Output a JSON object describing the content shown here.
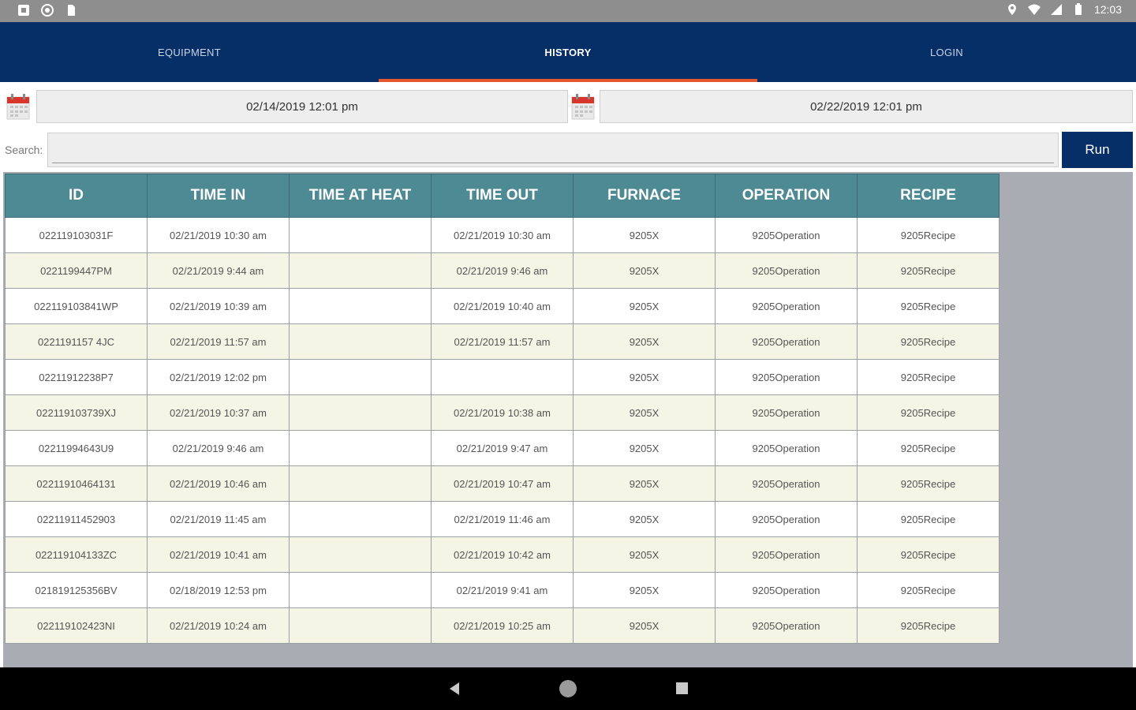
{
  "status_bar": {
    "time": "12:03"
  },
  "nav": {
    "tabs": [
      {
        "label": "EQUIPMENT",
        "active": false
      },
      {
        "label": "HISTORY",
        "active": true
      },
      {
        "label": "LOGIN",
        "active": false
      }
    ]
  },
  "dates": {
    "start": "02/14/2019 12:01 pm",
    "end": "02/22/2019 12:01 pm"
  },
  "search": {
    "label": "Search:",
    "value": "",
    "run_label": "Run"
  },
  "table": {
    "columns": [
      "ID",
      "TIME IN",
      "TIME AT HEAT",
      "TIME OUT",
      "FURNACE",
      "OPERATION",
      "RECIPE"
    ],
    "rows": [
      [
        "022119103031F",
        "02/21/2019 10:30 am",
        "",
        "02/21/2019 10:30 am",
        "9205X",
        "9205Operation",
        "9205Recipe"
      ],
      [
        "0221199447PM",
        "02/21/2019 9:44 am",
        "",
        "02/21/2019 9:46 am",
        "9205X",
        "9205Operation",
        "9205Recipe"
      ],
      [
        "022119103841WP",
        "02/21/2019 10:39 am",
        "",
        "02/21/2019 10:40 am",
        "9205X",
        "9205Operation",
        "9205Recipe"
      ],
      [
        "0221191157 4JC",
        "02/21/2019 11:57 am",
        "",
        "02/21/2019 11:57 am",
        "9205X",
        "9205Operation",
        "9205Recipe"
      ],
      [
        "02211912238P7",
        "02/21/2019 12:02 pm",
        "",
        "",
        "9205X",
        "9205Operation",
        "9205Recipe"
      ],
      [
        "022119103739XJ",
        "02/21/2019 10:37 am",
        "",
        "02/21/2019 10:38 am",
        "9205X",
        "9205Operation",
        "9205Recipe"
      ],
      [
        "02211994643U9",
        "02/21/2019 9:46 am",
        "",
        "02/21/2019 9:47 am",
        "9205X",
        "9205Operation",
        "9205Recipe"
      ],
      [
        "02211910464131",
        "02/21/2019 10:46 am",
        "",
        "02/21/2019 10:47 am",
        "9205X",
        "9205Operation",
        "9205Recipe"
      ],
      [
        "02211911452903",
        "02/21/2019 11:45 am",
        "",
        "02/21/2019 11:46 am",
        "9205X",
        "9205Operation",
        "9205Recipe"
      ],
      [
        "022119104133ZC",
        "02/21/2019 10:41 am",
        "",
        "02/21/2019 10:42 am",
        "9205X",
        "9205Operation",
        "9205Recipe"
      ],
      [
        "021819125356BV",
        "02/18/2019 12:53 pm",
        "",
        "02/21/2019 9:41 am",
        "9205X",
        "9205Operation",
        "9205Recipe"
      ],
      [
        "022119102423NI",
        "02/21/2019 10:24 am",
        "",
        "02/21/2019 10:25 am",
        "9205X",
        "9205Operation",
        "9205Recipe"
      ]
    ]
  },
  "colors": {
    "brand": "#062f68",
    "tab_indicator": "#e4572e",
    "table_header": "#4e8a94",
    "row_alt": "#f5f5e6"
  }
}
